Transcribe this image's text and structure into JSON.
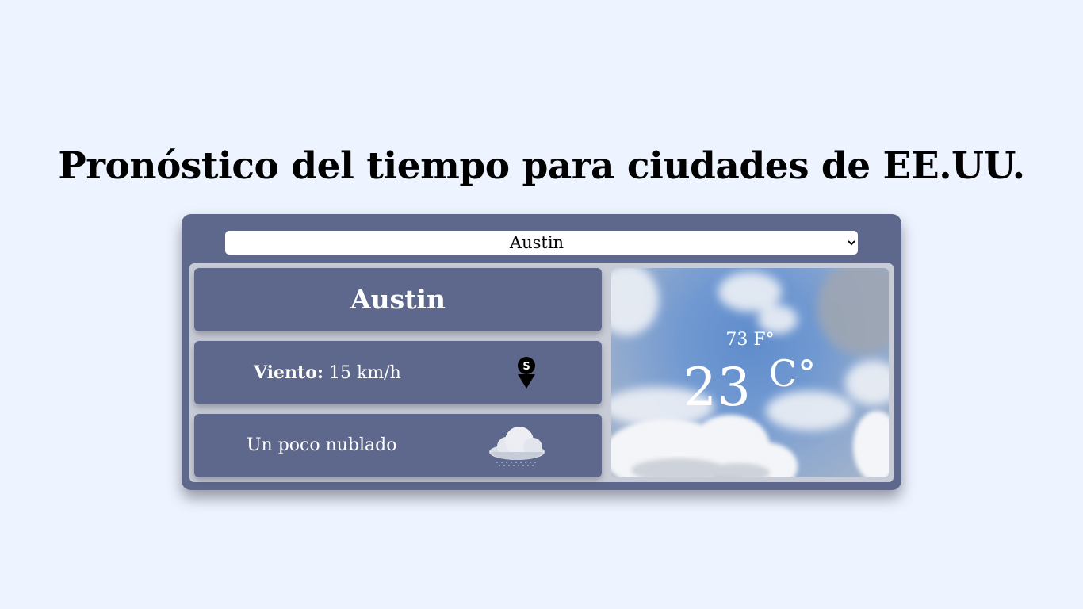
{
  "page": {
    "title": "Pronóstico del tiempo para ciudades de EE.UU."
  },
  "selector": {
    "selected": "Austin",
    "options": [
      "Austin"
    ]
  },
  "weather": {
    "city": "Austin",
    "wind_label": "Viento:",
    "wind_value": "15 km/h",
    "condition": "Un poco nublado",
    "temp_f": "73 F°",
    "temp_c_value": "23",
    "temp_c_unit": "C°"
  },
  "icons": {
    "wind": "location-pin-icon",
    "condition": "cloud-snow-icon"
  },
  "colors": {
    "background": "#eef4ff",
    "card": "#5e688c",
    "panel": "#c8ccd6"
  }
}
